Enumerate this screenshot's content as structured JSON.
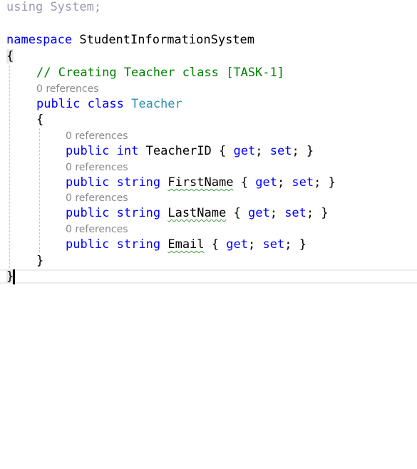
{
  "editor": {
    "using_kw": "using",
    "using_ns": "System",
    "using_semicolon": ";",
    "namespace_kw": "namespace",
    "namespace_name": "StudentInformationSystem",
    "ns_open_brace": "{",
    "ns_close_brace": "}",
    "comment": "// Creating Teacher class [TASK-1]",
    "class_refs": "0 references",
    "class_public": "public",
    "class_kw": "class",
    "class_name": "Teacher",
    "class_open_brace": "{",
    "class_close_brace": "}",
    "properties": [
      {
        "refs": "0 references",
        "access": "public",
        "type": "int",
        "name": "TeacherID",
        "open": "{",
        "get": "get",
        "set": "set",
        "close": "}"
      },
      {
        "refs": "0 references",
        "access": "public",
        "type": "string",
        "name": "FirstName",
        "open": "{",
        "get": "get",
        "set": "set",
        "close": "}"
      },
      {
        "refs": "0 references",
        "access": "public",
        "type": "string",
        "name": "LastName",
        "open": "{",
        "get": "get",
        "set": "set",
        "close": "}"
      },
      {
        "refs": "0 references",
        "access": "public",
        "type": "string",
        "name": "Email",
        "open": "{",
        "get": "get",
        "set": "set",
        "close": "}"
      }
    ]
  },
  "colors": {
    "keyword": "#0000ff",
    "type": "#2b91af",
    "comment": "#008000",
    "codelens": "#8a8a8a",
    "squiggle": "#3aa03a"
  }
}
